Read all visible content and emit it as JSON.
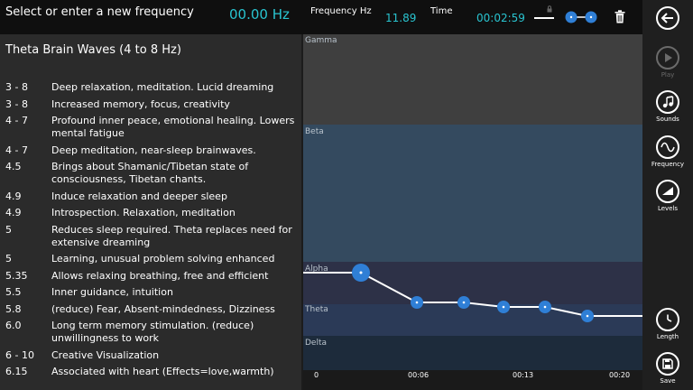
{
  "header": {
    "prompt": "Select or enter a new frequency",
    "entered_frequency": "00.00 Hz",
    "frequency_label": "Frequency Hz",
    "current_frequency": "11.89",
    "time_label": "Time",
    "current_time": "00:02:59"
  },
  "panel": {
    "title": "Theta Brain Waves (4 to 8 Hz)",
    "rows": [
      {
        "range": "3 - 8",
        "description": "Deep relaxation, meditation. Lucid dreaming"
      },
      {
        "range": "3 - 8",
        "description": "Increased memory, focus, creativity"
      },
      {
        "range": "4 - 7",
        "description": "Profound inner peace, emotional healing. Lowers mental fatigue"
      },
      {
        "range": "4 - 7",
        "description": "Deep meditation, near-sleep brainwaves."
      },
      {
        "range": "4.5",
        "description": "Brings about Shamanic/Tibetan state of consciousness, Tibetan chants."
      },
      {
        "range": "4.9",
        "description": "Induce relaxation and deeper sleep"
      },
      {
        "range": "4.9",
        "description": "Introspection. Relaxation, meditation"
      },
      {
        "range": "5",
        "description": "Reduces sleep required. Theta replaces need for extensive dreaming"
      },
      {
        "range": "5",
        "description": "Learning, unusual problem solving enhanced"
      },
      {
        "range": "5.35",
        "description": "Allows relaxing breathing, free and efficient"
      },
      {
        "range": "5.5",
        "description": "Inner guidance, intuition"
      },
      {
        "range": "5.8",
        "description": "(reduce) Fear, Absent-mindedness, Dizziness"
      },
      {
        "range": "6.0",
        "description": "Long term memory stimulation. (reduce) unwillingness to work"
      },
      {
        "range": "6 - 10",
        "description": "Creative Visualization"
      },
      {
        "range": "6.15",
        "description": "Associated with heart (Effects=love,warmth)"
      }
    ]
  },
  "chart": {
    "bands": [
      "Gamma",
      "Beta",
      "Alpha",
      "Theta",
      "Delta"
    ],
    "x_ticks": [
      "0",
      "00:06",
      "00:13",
      "00:20"
    ],
    "colors": {
      "gamma": "#3f3f3f",
      "beta": "#344a5f",
      "alpha": "#2d3147",
      "theta": "#2b3a57",
      "delta": "#1d2b3b",
      "point": "#2f7fd6",
      "line": "#ffffff"
    }
  },
  "appbar": {
    "play": "Play",
    "sounds": "Sounds",
    "frequency": "Frequency",
    "levels": "Levels",
    "length": "Length",
    "save": "Save"
  },
  "icons": [
    "back-arrow-icon",
    "play-icon",
    "music-note-icon",
    "sine-wave-icon",
    "levels-icon",
    "clock-icon",
    "save-icon",
    "trash-icon",
    "lock-icon"
  ]
}
